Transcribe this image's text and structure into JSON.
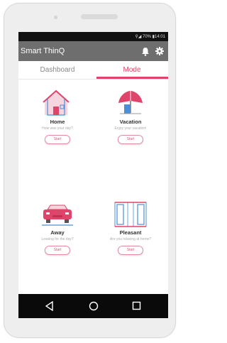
{
  "status": {
    "text": "⚲◢ 70% ▮14:01"
  },
  "appbar": {
    "title": "Smart ThinQ",
    "icons": [
      "bell-icon",
      "gear-icon"
    ]
  },
  "tabs": [
    {
      "label": "Dashboard",
      "active": false
    },
    {
      "label": "Mode",
      "active": true
    }
  ],
  "modes": [
    {
      "title": "Home",
      "subtitle": "How was your day?",
      "button": "Start",
      "icon": "house-icon"
    },
    {
      "title": "Vacation",
      "subtitle": "Enjoy your vacation!",
      "button": "Start",
      "icon": "umbrella-icon"
    },
    {
      "title": "Away",
      "subtitle": "Leaving for the day?",
      "button": "Start",
      "icon": "car-icon"
    },
    {
      "title": "Pleasant",
      "subtitle": "Are you relaxing at home?",
      "button": "Start",
      "icon": "window-icon"
    }
  ],
  "nav": [
    "back-icon",
    "home-icon",
    "recents-icon"
  ],
  "colors": {
    "accent": "#e0446b",
    "appbar": "#6e6e6e",
    "blue": "#4a8fd8"
  }
}
